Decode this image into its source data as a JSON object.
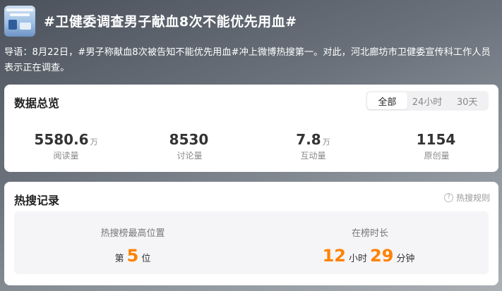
{
  "topic": {
    "title": "#卫健委调查男子献血8次不能优先用血#",
    "intro": "导语：8月22日，#男子称献血8次被告知不能优先用血#冲上微博热搜第一。对此，河北廊坊市卫健委宣传科工作人员表示正在调查。"
  },
  "overview": {
    "title": "数据总览",
    "tabs": [
      "全部",
      "24小时",
      "30天"
    ],
    "active_tab": "全部",
    "stats": [
      {
        "value": "5580.6",
        "unit": "万",
        "label": "阅读量"
      },
      {
        "value": "8530",
        "unit": "",
        "label": "讨论量"
      },
      {
        "value": "7.8",
        "unit": "万",
        "label": "互动量"
      },
      {
        "value": "1154",
        "unit": "",
        "label": "原创量"
      }
    ]
  },
  "hot": {
    "title": "热搜记录",
    "rule_link": "热搜规则",
    "rule_icon": "?",
    "highest": {
      "label": "热搜榜最高位置",
      "prefix": "第",
      "value": "5",
      "suffix": "位"
    },
    "duration": {
      "label": "在榜时长",
      "hours": "12",
      "hours_unit": "小时",
      "minutes": "29",
      "minutes_unit": "分钟"
    }
  },
  "colors": {
    "accent": "#ff8200"
  }
}
